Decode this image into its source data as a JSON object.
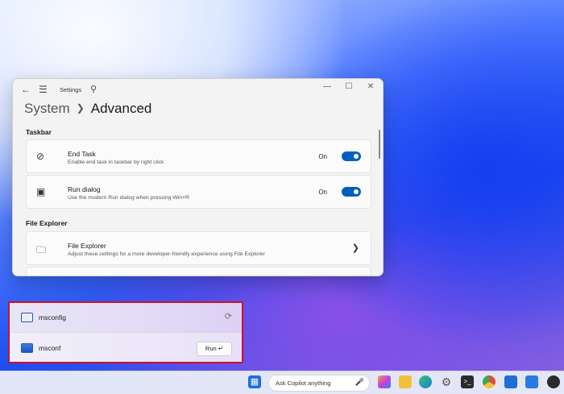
{
  "settings": {
    "title": "Settings",
    "breadcrumb_parent": "System",
    "breadcrumb_current": "Advanced",
    "icons": {
      "back": "arrow-left-icon",
      "menu": "hamburger-icon",
      "search": "search-icon",
      "minimize": "minimize-icon",
      "maximize": "maximize-icon",
      "close": "close-icon"
    },
    "taskbar_section": {
      "title": "Taskbar",
      "items": [
        {
          "title": "End Task",
          "description": "Enable end task in taskbar by right click",
          "state": "On",
          "icon": "end-task-icon"
        },
        {
          "title": "Run dialog",
          "description": "Use the modern Run dialog when pressing Win+R",
          "state": "On",
          "icon": "run-dialog-icon"
        }
      ]
    },
    "explorer_section": {
      "title": "File Explorer",
      "items": [
        {
          "title": "File Explorer",
          "description": "Adjust these settings for a more developer-friendly experience using File Explorer",
          "icon": "folder-icon"
        }
      ]
    }
  },
  "run_dialog": {
    "suggestion": "msconfig",
    "input_value": "msconf",
    "run_button": "Run",
    "icons": {
      "suggestion": "window-app-icon",
      "history": "history-icon",
      "enter": "enter-icon"
    }
  },
  "taskbar": {
    "search_placeholder": "Ask Copilot anything",
    "apps": [
      "start-icon",
      "copilot-icon",
      "file-explorer-icon",
      "edge-icon",
      "settings-icon",
      "terminal-icon",
      "chrome-icon",
      "outlook-icon",
      "store-icon",
      "xbox-icon"
    ]
  },
  "colors": {
    "accent": "#0060c0",
    "highlight_border": "#d0102a"
  }
}
